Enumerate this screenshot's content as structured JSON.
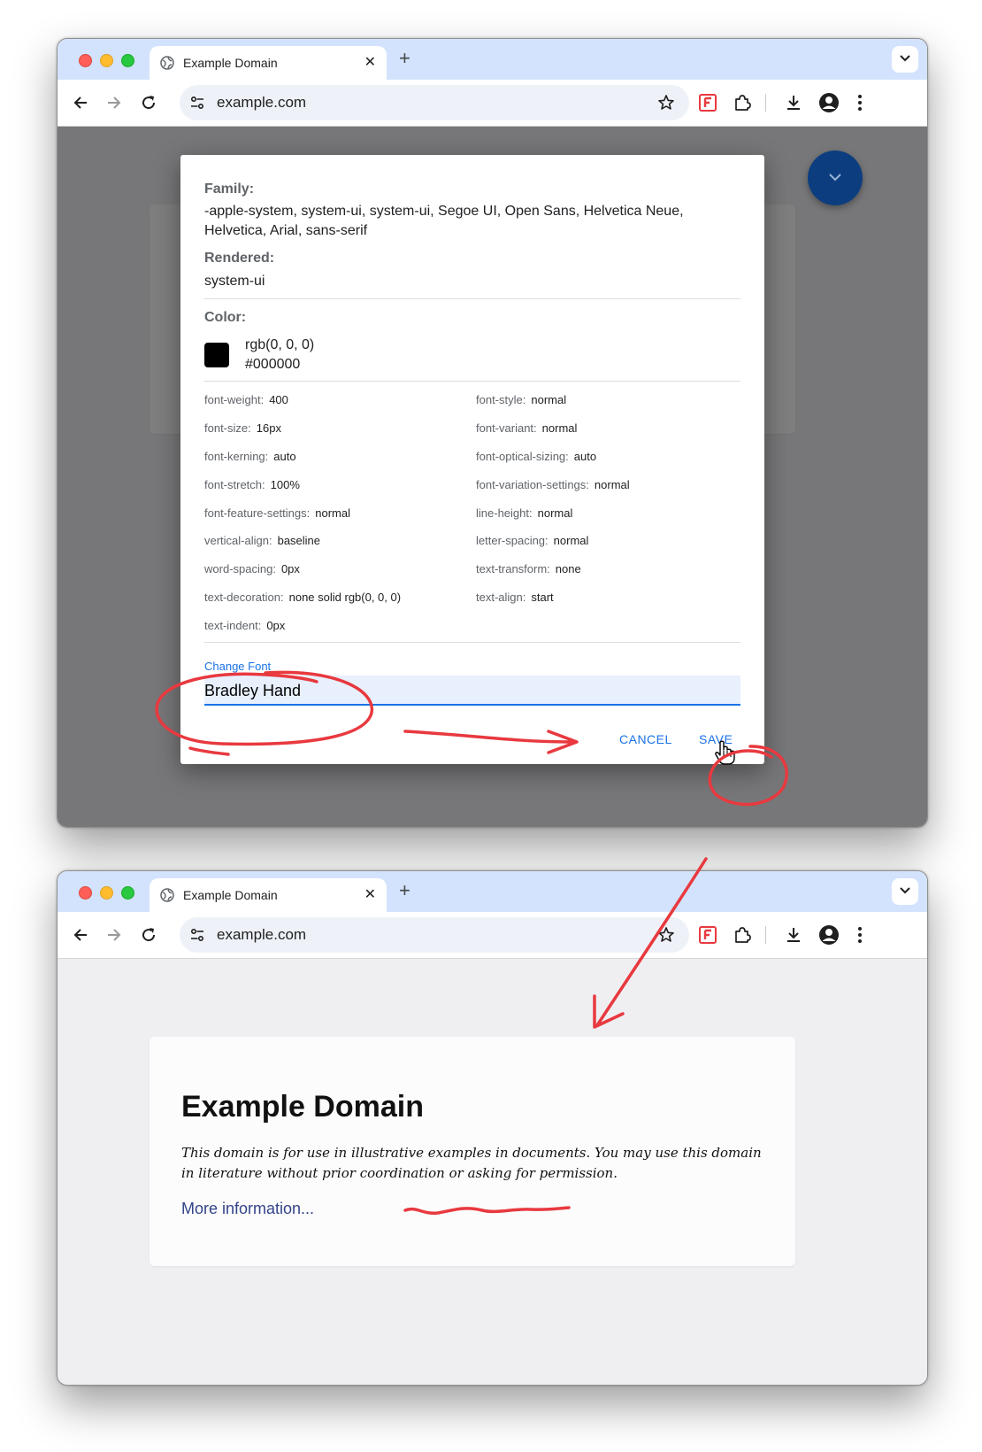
{
  "browser": {
    "tab_title": "Example Domain",
    "url": "example.com",
    "new_tab": "+",
    "close": "✕"
  },
  "dialog": {
    "family_label": "Family:",
    "family_value": "-apple-system, system-ui, system-ui, Segoe UI, Open Sans, Helvetica Neue, Helvetica, Arial, sans-serif",
    "rendered_label": "Rendered:",
    "rendered_value": "system-ui",
    "color_label": "Color:",
    "color_rgb": "rgb(0, 0, 0)",
    "color_hex": "#000000",
    "props_left": [
      {
        "key": "font-weight:",
        "value": "400"
      },
      {
        "key": "font-size:",
        "value": "16px"
      },
      {
        "key": "font-kerning:",
        "value": "auto"
      },
      {
        "key": "font-stretch:",
        "value": "100%"
      },
      {
        "key": "font-feature-settings:",
        "value": "normal"
      },
      {
        "key": "vertical-align:",
        "value": "baseline"
      },
      {
        "key": "word-spacing:",
        "value": "0px"
      },
      {
        "key": "text-decoration:",
        "value": "none solid rgb(0, 0, 0)"
      },
      {
        "key": "text-indent:",
        "value": "0px"
      }
    ],
    "props_right": [
      {
        "key": "font-style:",
        "value": "normal"
      },
      {
        "key": "font-variant:",
        "value": "normal"
      },
      {
        "key": "font-optical-sizing:",
        "value": "auto"
      },
      {
        "key": "font-variation-settings:",
        "value": "normal"
      },
      {
        "key": "line-height:",
        "value": "normal"
      },
      {
        "key": "letter-spacing:",
        "value": "normal"
      },
      {
        "key": "text-transform:",
        "value": "none"
      },
      {
        "key": "text-align:",
        "value": "start"
      }
    ],
    "change_font_label": "Change Font",
    "change_font_value": "Bradley Hand",
    "cancel": "CANCEL",
    "save": "SAVE"
  },
  "page": {
    "title": "Example Domain",
    "description": "This domain is for use in illustrative examples in documents. You may use this domain in literature without prior coordination or asking for permission.",
    "link": "More information..."
  },
  "colors": {
    "accent": "#1a73e8",
    "tabstrip": "#d3e3fd",
    "annotation": "#e8393f",
    "fab": "#0c3e7f"
  }
}
